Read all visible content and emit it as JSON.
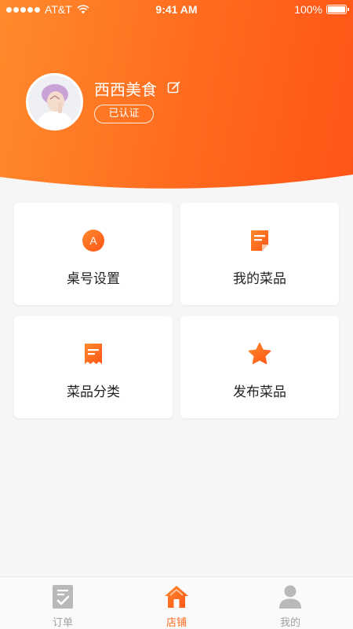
{
  "status_bar": {
    "carrier": "AT&T",
    "time": "9:41 AM",
    "battery": "100%"
  },
  "profile": {
    "shop_name": "西西美食",
    "badge": "已认证"
  },
  "menu": [
    {
      "label": "桌号设置",
      "icon": "letter-a-icon"
    },
    {
      "label": "我的菜品",
      "icon": "document-icon"
    },
    {
      "label": "菜品分类",
      "icon": "receipt-icon"
    },
    {
      "label": "发布菜品",
      "icon": "star-icon"
    }
  ],
  "tabbar": {
    "items": [
      {
        "label": "订单",
        "icon": "clipboard-check-icon"
      },
      {
        "label": "店铺",
        "icon": "home-icon"
      },
      {
        "label": "我的",
        "icon": "user-icon"
      }
    ],
    "active": "店铺"
  },
  "colors": {
    "accent": "#ff6a1e",
    "accent_light": "#ff8a2c",
    "tab_inactive": "#a0a0a0"
  }
}
